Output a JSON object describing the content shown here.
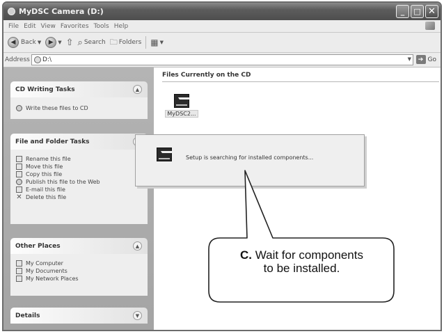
{
  "window": {
    "title": "MyDSC Camera (D:)"
  },
  "menu": [
    "File",
    "Edit",
    "View",
    "Favorites",
    "Tools",
    "Help"
  ],
  "toolbar": {
    "back": "Back",
    "search": "Search",
    "folders": "Folders"
  },
  "address": {
    "label": "Address",
    "value": "D:\\",
    "go": "Go"
  },
  "panels": {
    "cd_tasks": {
      "title": "CD Writing Tasks",
      "items": [
        {
          "label": "Write these files to CD",
          "icon": "write-cd-icon"
        }
      ]
    },
    "file_tasks": {
      "title": "File and Folder Tasks",
      "items": [
        {
          "label": "Rename this file",
          "icon": "rename-icon"
        },
        {
          "label": "Move this file",
          "icon": "move-icon"
        },
        {
          "label": "Copy this file",
          "icon": "copy-icon"
        },
        {
          "label": "Publish this file to the Web",
          "icon": "web-icon"
        },
        {
          "label": "E-mail this file",
          "icon": "email-icon"
        },
        {
          "label": "Delete this file",
          "icon": "delete-icon"
        }
      ]
    },
    "other_places": {
      "title": "Other Places",
      "items": [
        {
          "label": "My Computer",
          "icon": "computer-icon"
        },
        {
          "label": "My Documents",
          "icon": "documents-icon"
        },
        {
          "label": "My Network Places",
          "icon": "network-icon"
        }
      ]
    },
    "details": {
      "title": "Details"
    }
  },
  "content": {
    "header": "Files Currently on the CD",
    "file_label": "MyDSC2..."
  },
  "dialog": {
    "message": "Setup is searching for installed components..."
  },
  "callout": {
    "letter": "C.",
    "line1": "Wait for components",
    "line2": "to be installed."
  }
}
